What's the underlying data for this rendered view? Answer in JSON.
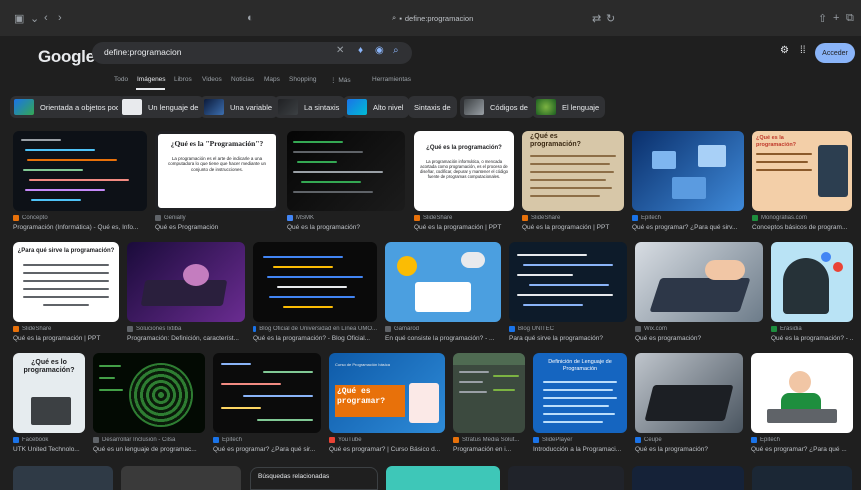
{
  "browser": {
    "address": "define:programacion",
    "lock_icon": "lock-icon"
  },
  "google": {
    "logo": "Google",
    "query": "define:programacion",
    "signin_label": "Acceder"
  },
  "tabs": [
    "Todo",
    "Imágenes",
    "Libros",
    "Videos",
    "Noticias",
    "Maps",
    "Shopping",
    "Más",
    "Herramientas"
  ],
  "active_tab": "Imágenes",
  "chips": [
    "Orientada a objetos poo",
    "Un lenguaje de",
    "Una variable",
    "La sintaxis",
    "Alto nivel",
    "Sintaxis de",
    "Códigos de",
    "El lenguaje"
  ],
  "results": [
    {
      "source": "Concepto",
      "caption": "Programación (Informática) - Qué es, Info...",
      "favicon_color": "#e8710a"
    },
    {
      "source": "Genially",
      "caption": "Qué es Programación",
      "favicon_color": "#5f6368"
    },
    {
      "source": "MSMK",
      "caption": "Qué es la programación?",
      "favicon_color": "#4285f4"
    },
    {
      "source": "SlideShare",
      "caption": "Qué es la programación | PPT",
      "favicon_color": "#e8710a"
    },
    {
      "source": "SlideShare",
      "caption": "Qué es la programación | PPT",
      "favicon_color": "#e8710a"
    },
    {
      "source": "Epitech",
      "caption": "Qué es programar? ¿Para qué sirv...",
      "favicon_color": "#1a73e8"
    },
    {
      "source": "Monografias.com",
      "caption": "Conceptos básicos de program...",
      "favicon_color": "#1e8e3e"
    },
    {
      "source": "SlideShare",
      "caption": "Qué es la programación | PPT",
      "favicon_color": "#e8710a"
    },
    {
      "source": "Soluciones Ixtiba",
      "caption": "Programación: Definición, característ...",
      "favicon_color": "#5f6368"
    },
    {
      "source": "Blog Oficial de Universidad en Línea UMO...",
      "caption": "Qué es la programación? - Blog Oficial...",
      "favicon_color": "#1a73e8"
    },
    {
      "source": "Gamarod",
      "caption": "En qué consiste la programación? - ...",
      "favicon_color": "#5f6368"
    },
    {
      "source": "Blog UNITEC",
      "caption": "Para qué sirve la programación?",
      "favicon_color": "#1a73e8"
    },
    {
      "source": "Wix.com",
      "caption": "Qué es programación?",
      "favicon_color": "#5f6368"
    },
    {
      "source": "Erasidia",
      "caption": "Qué es la programación? - ...",
      "favicon_color": "#1e8e3e"
    },
    {
      "source": "Facebook",
      "caption": "UTK United Technolo...",
      "favicon_color": "#1a73e8"
    },
    {
      "source": "Desarrollar Inclusión - Cilsa",
      "caption": "Qué es un lenguaje de programac...",
      "favicon_color": "#5f6368"
    },
    {
      "source": "Epitech",
      "caption": "Qué es programar? ¿Para qué sir...",
      "favicon_color": "#1a73e8"
    },
    {
      "source": "YouTube",
      "caption": "Qué es programar? | Curso Básico d...",
      "favicon_color": "#ea4335"
    },
    {
      "source": "Stratus Media Solut...",
      "caption": "Programación en i...",
      "favicon_color": "#e8710a"
    },
    {
      "source": "SlidePlayer",
      "caption": "Introducción a la Programaci...",
      "favicon_color": "#1a73e8"
    },
    {
      "source": "Ceupe",
      "caption": "Qué es la programación?",
      "favicon_color": "#1a73e8"
    },
    {
      "source": "Epitech",
      "caption": "Qué es programar? ¿Para qué ...",
      "favicon_color": "#1a73e8"
    }
  ],
  "thumb_text": {
    "genially_title": "¿Qué es la \"Programación\"?",
    "genially_body": "La programación es el arte de indicarle a una computadora lo que tiene que hacer mediante un conjunto de instrucciones.",
    "slideshare_title": "¿Qué es la programación?",
    "slideshare_body": "La programación informática, o mencada acortada como programación, es el proceso de diseñar, codificar, depurar y mantener el código fuente de programas computacionales.",
    "slideshare2_title": "¿Qué es programación?",
    "monografias_title": "¿Qué es la programación?",
    "para_title": "¿Para qué sirve la programación?",
    "que_es_lo": "¿Qué es lo programación?",
    "youtube_title": "¿Qué es programar?",
    "youtube_sub": "Curso de Programación básica",
    "slideplayer_title": "Definición de Lenguaje de Programación"
  },
  "related": {
    "title": "Búsquedas relacionadas"
  }
}
